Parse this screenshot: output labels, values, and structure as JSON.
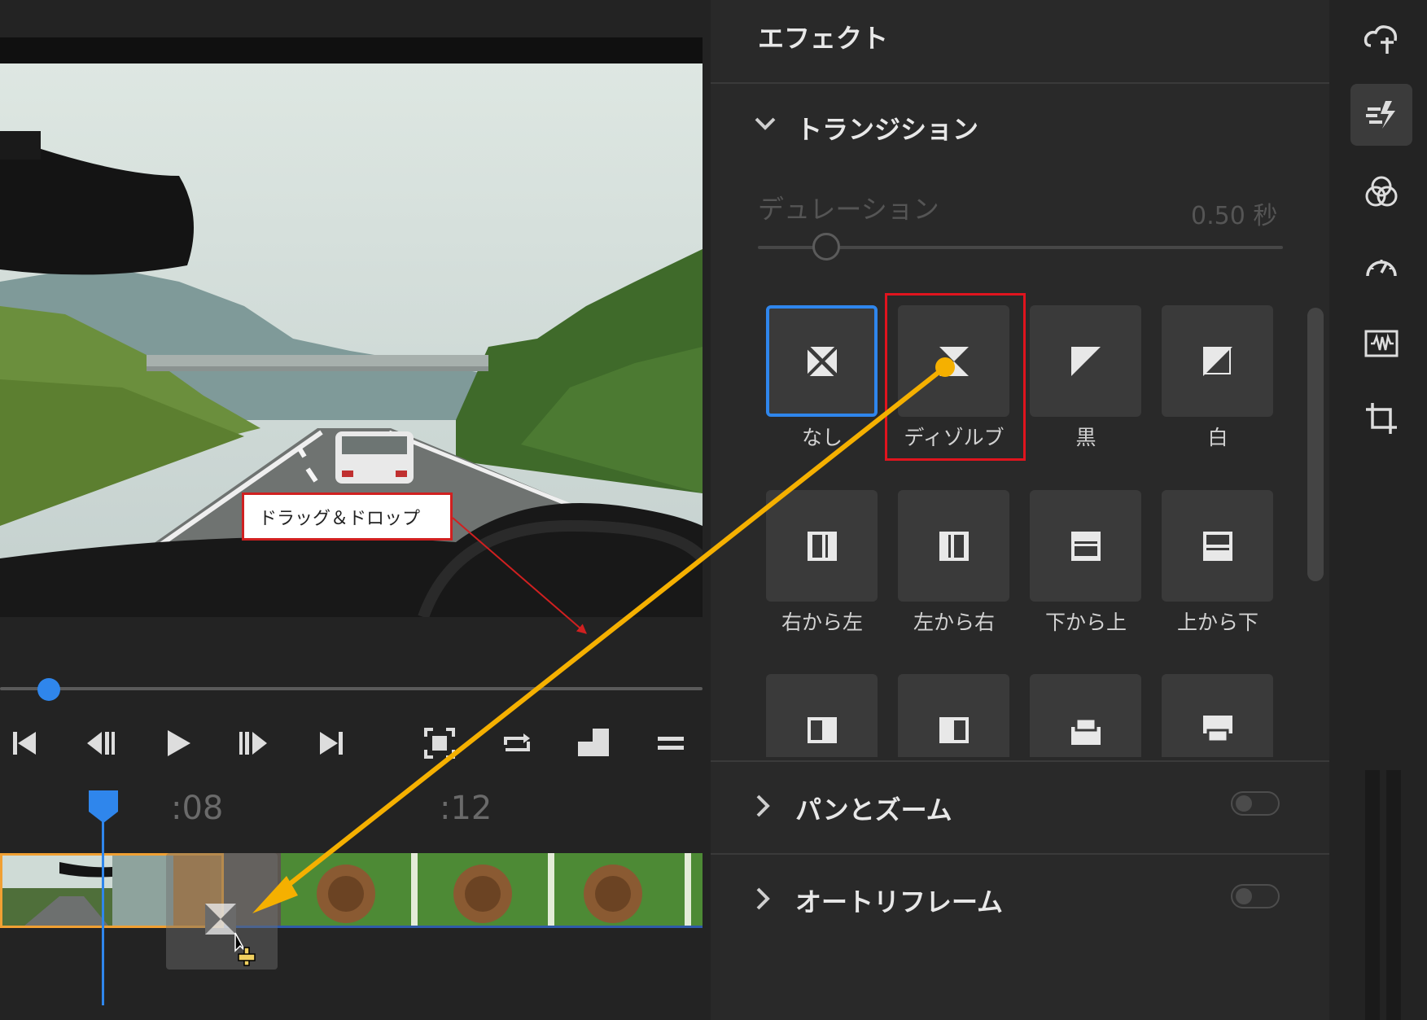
{
  "panel": {
    "title": "エフェクト",
    "transition_section": "トランジション",
    "duration_label": "デュレーション",
    "duration_value": "0.50 秒",
    "duration_fraction": 0.13,
    "tiles": [
      {
        "label": "なし",
        "icon": "none-transition-icon",
        "selected": true
      },
      {
        "label": "ディゾルブ",
        "icon": "dissolve-transition-icon"
      },
      {
        "label": "黒",
        "icon": "black-fade-icon"
      },
      {
        "label": "白",
        "icon": "white-fade-icon"
      },
      {
        "label": "右から左",
        "icon": "wipe-right-left-icon"
      },
      {
        "label": "左から右",
        "icon": "wipe-left-right-icon"
      },
      {
        "label": "下から上",
        "icon": "wipe-bottom-top-icon"
      },
      {
        "label": "上から下",
        "icon": "wipe-top-bottom-icon"
      },
      {
        "label": "",
        "icon": "push-left-icon"
      },
      {
        "label": "",
        "icon": "push-right-icon"
      },
      {
        "label": "",
        "icon": "push-up-icon"
      },
      {
        "label": "",
        "icon": "push-down-icon"
      }
    ],
    "pan_zoom": {
      "label": "パンとズーム",
      "enabled": false
    },
    "auto_reframe": {
      "label": "オートリフレーム",
      "enabled": false
    }
  },
  "player": {
    "scrub_fraction": 0.07,
    "controls": [
      "skip-to-start-icon",
      "step-back-icon",
      "play-icon",
      "step-forward-icon",
      "skip-to-end-icon",
      "fit-frame-icon",
      "loop-icon",
      "aspect-icon",
      "menu-icon"
    ]
  },
  "timeline": {
    "ruler_labels": [
      ":08",
      ":12"
    ]
  },
  "annotation": {
    "callout_text": "ドラッグ＆ドロップ"
  },
  "rail_icons": [
    "upload-icon",
    "transition-effects-icon",
    "color-icon",
    "speed-icon",
    "audio-icon",
    "crop-icon"
  ],
  "colors": {
    "accent": "#2f86ec",
    "clip_border": "#f0a033",
    "arrow": "#f5b000",
    "highlight": "#e0141e"
  }
}
